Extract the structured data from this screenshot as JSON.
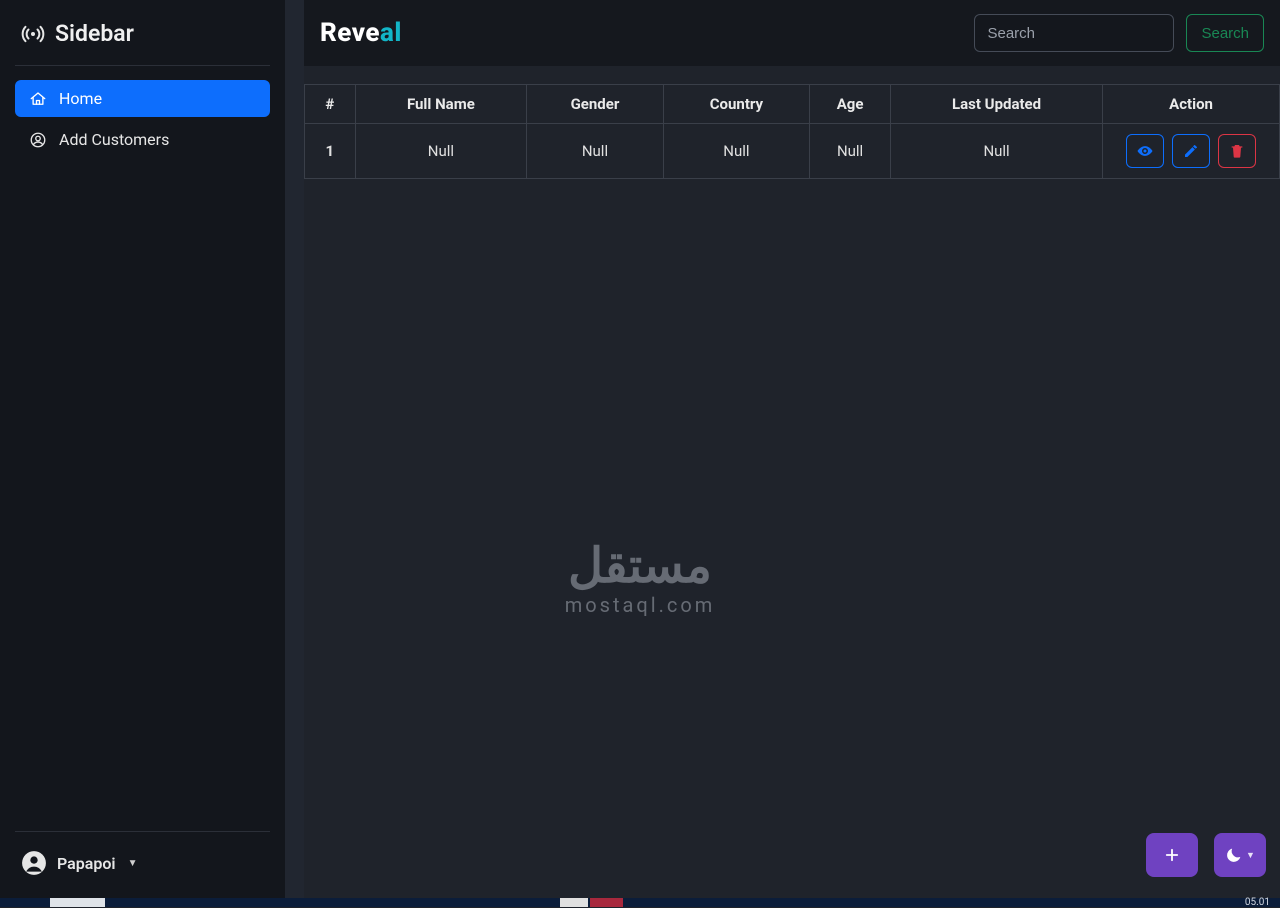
{
  "sidebar": {
    "title": "Sidebar",
    "items": [
      {
        "label": "Home",
        "icon": "home-icon",
        "active": true
      },
      {
        "label": "Add Customers",
        "icon": "user-circle-icon",
        "active": false
      }
    ],
    "user": {
      "name": "Papapoi"
    }
  },
  "brand": {
    "part1": "Reve",
    "part2": "al"
  },
  "search": {
    "placeholder": "Search",
    "button_label": "Search"
  },
  "table": {
    "headers": [
      "#",
      "Full Name",
      "Gender",
      "Country",
      "Age",
      "Last Updated",
      "Action"
    ],
    "rows": [
      {
        "idx": "1",
        "full_name": "Null",
        "gender": "Null",
        "country": "Null",
        "age": "Null",
        "last_updated": "Null"
      }
    ]
  },
  "actions": {
    "view": "view-button",
    "edit": "edit-button",
    "delete": "delete-button"
  },
  "fab": {
    "add_label": "+",
    "theme_label": "theme"
  },
  "watermark": {
    "line1": "مستقل",
    "line2": "mostaql.com"
  },
  "taskbar": {
    "time": "05.01"
  },
  "colors": {
    "primary": "#0d6efd",
    "success": "#198754",
    "danger": "#dc3545",
    "purple": "#6f42c1",
    "teal": "#12b5c7"
  }
}
